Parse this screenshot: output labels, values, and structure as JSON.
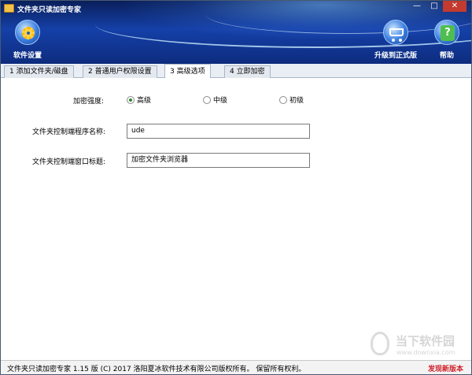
{
  "window": {
    "title": "文件夹只读加密专家",
    "controls": {
      "minimize": "—",
      "maximize": "□",
      "close": "✕"
    }
  },
  "toolbar": {
    "settings_label": "软件设置",
    "upgrade_label": "升级到正式版",
    "help_label": "帮助",
    "help_glyph": "?"
  },
  "tabs": [
    {
      "label": "1 添加文件夹/磁盘",
      "active": false
    },
    {
      "label": "2 普通用户权限设置",
      "active": false
    },
    {
      "label": "3 高级选项",
      "active": true
    },
    {
      "label": "4 立即加密",
      "active": false
    }
  ],
  "advanced": {
    "strength": {
      "label": "加密强度:",
      "options": [
        "高级",
        "中级",
        "初级"
      ],
      "selected": "高级"
    },
    "program_name": {
      "label": "文件夹控制端程序名称:",
      "value": "ude"
    },
    "window_title": {
      "label": "文件夹控制端窗口标题:",
      "value": "加密文件夹浏览器"
    }
  },
  "statusbar": {
    "copyright": "文件夹只读加密专家 1.15 版 (C) 2017 洛阳夏冰软件技术有限公司版权所有。 保留所有权利。",
    "update_link": "发现新版本"
  },
  "watermark": {
    "text": "当下软件园",
    "url": "www.downxia.com"
  },
  "colors": {
    "header": "#1540a8",
    "accent_green": "#2a8a2a",
    "update_red": "#d0202a"
  }
}
